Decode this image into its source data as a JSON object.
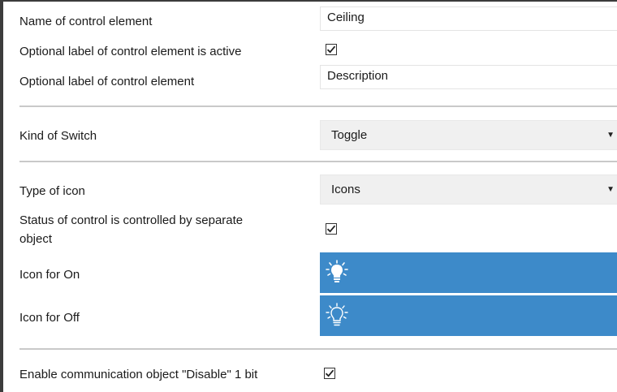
{
  "control_name": {
    "label": "Name of control element",
    "value": "Ceiling"
  },
  "optional_label_active": {
    "label": "Optional label of control element is active",
    "checked": true
  },
  "optional_label": {
    "label": "Optional label of control element",
    "value": "Description"
  },
  "kind_of_switch": {
    "label": "Kind of Switch",
    "value": "Toggle"
  },
  "type_of_icon": {
    "label": "Type of icon",
    "value": "Icons"
  },
  "status_separate": {
    "label_line1": "Status of control is controlled by separate",
    "label_line2": "object",
    "checked": true
  },
  "icon_on": {
    "label": "Icon for On",
    "icon": "lightbulb-on-icon",
    "color": "#3d8ac9"
  },
  "icon_off": {
    "label": "Icon for Off",
    "icon": "lightbulb-off-icon",
    "color": "#3d8ac9"
  },
  "disable_object": {
    "label": "Enable communication object \"Disable\" 1 bit",
    "checked": true
  }
}
